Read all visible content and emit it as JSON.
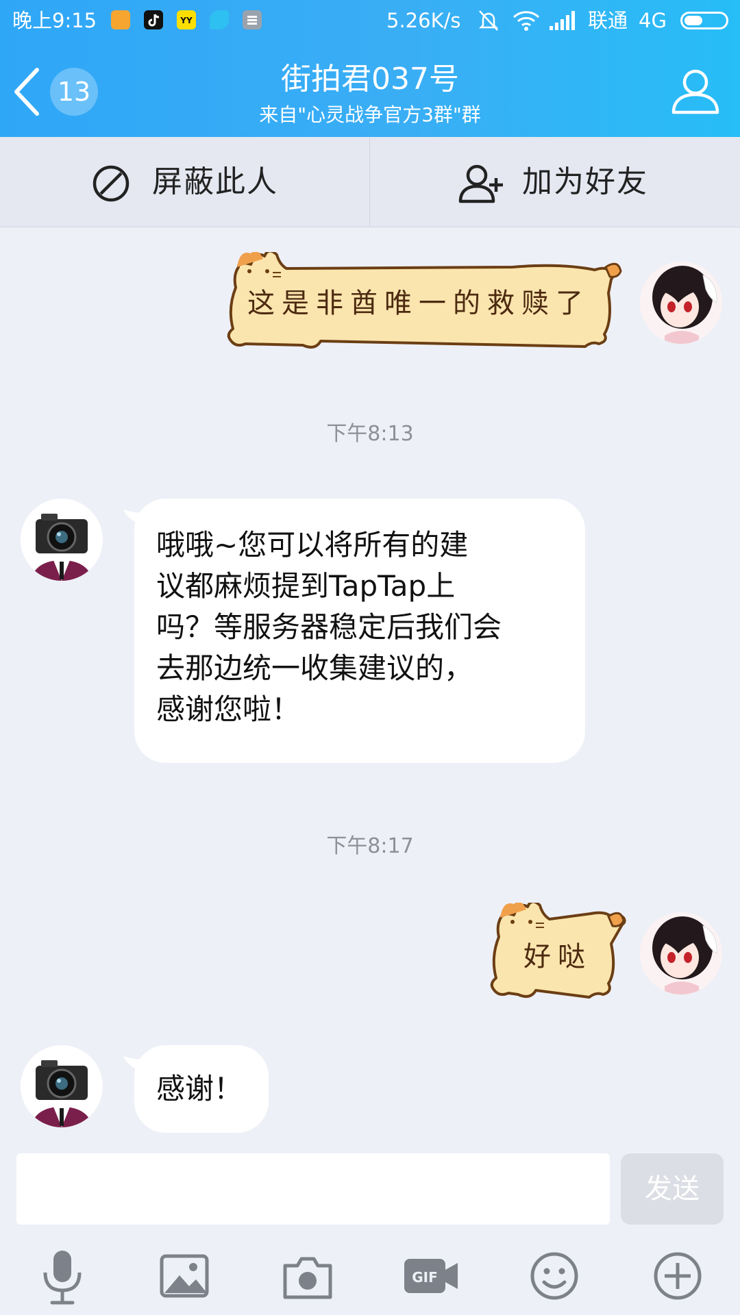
{
  "status_bar": {
    "time": "晚上9:15",
    "net_speed": "5.26K/s",
    "carrier": "联通",
    "network": "4G",
    "battery_level": 0.45,
    "app_icons": [
      "message-app-icon",
      "tiktok-app-icon",
      "yy-app-icon",
      "bird-app-icon",
      "notes-app-icon"
    ]
  },
  "header": {
    "unread_count": "13",
    "title": "街拍君037号",
    "subtitle": "来自\"心灵战争官方3群\"群",
    "background": "#2fa7f7"
  },
  "actions": {
    "block_label": "屏蔽此人",
    "add_friend_label": "加为好友"
  },
  "messages": [
    {
      "from": "me",
      "type": "sticker",
      "text": "这是非酋唯一的救赎了"
    },
    {
      "type": "timestamp",
      "text": "下午8:13"
    },
    {
      "from": "other",
      "type": "text",
      "lines": [
        "哦哦~您可以将所有的建",
        "议都麻烦提到TapTap上",
        "吗？等服务器稳定后我们会",
        "去那边统一收集建议的，",
        "感谢您啦！"
      ]
    },
    {
      "type": "timestamp",
      "text": "下午8:17"
    },
    {
      "from": "me",
      "type": "sticker",
      "text": "好哒"
    },
    {
      "from": "other",
      "type": "text",
      "lines": [
        "感谢！"
      ]
    }
  ],
  "composer": {
    "input_value": "",
    "send_label": "发送",
    "tools": [
      "microphone-icon",
      "image-icon",
      "camera-icon",
      "gif-icon",
      "emoji-icon",
      "plus-icon"
    ]
  },
  "colors": {
    "page_bg": "#eef0f7",
    "bubble_bg": "#ffffff",
    "sticker_fill": "#fbe5ae",
    "sticker_outline": "#6b3e14",
    "cat_orange": "#f0a04b"
  }
}
